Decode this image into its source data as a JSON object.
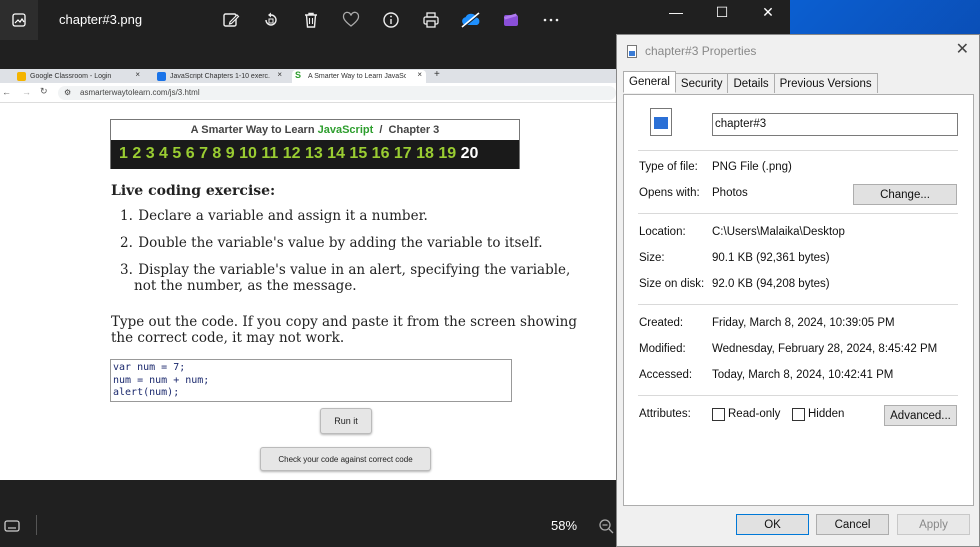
{
  "photos": {
    "file_name": "chapter#3.png",
    "zoom": "58%",
    "toolbar_icons": [
      "edit-image-icon",
      "rotate-icon",
      "delete-icon",
      "favorite-icon",
      "info-icon",
      "print-icon",
      "onedrive-icon",
      "clipchamp-icon",
      "more-icon"
    ],
    "window_controls": {
      "minimize": "—",
      "maximize": "☐",
      "close": "✕"
    }
  },
  "browser": {
    "tabs": [
      {
        "title": "Google Classroom - Login",
        "fav_color": "#f4b400"
      },
      {
        "title": "JavaScript Chapters 1-10 exerc...",
        "fav_color": "#1a73e8"
      },
      {
        "title": "A Smarter Way to Learn JavaSc...",
        "fav_color": "#2e9e2e",
        "active": true
      }
    ],
    "url": "asmarterwaytolearn.com/js/3.html"
  },
  "page": {
    "nav_title_prefix": "A Smarter Way to Learn ",
    "nav_title_js": "JavaScript",
    "nav_title_suffix": "  /  Chapter 3",
    "chapters": "1 2 3 4 5 6 7 8 9 10 11 12 13 14 15 16 17 18 19",
    "current_chapter": "20",
    "exercise_heading": "Live coding exercise:",
    "steps": [
      "Declare a variable and assign it a number.",
      "Double the variable's value by adding the variable to itself.",
      "Display the variable's value in an alert, specifying the variable, not the number, as the message."
    ],
    "instruction": "Type out the code. If you copy and paste it from the screen showing the correct code, it may not work.",
    "code": "var num = 7;\nnum = num + num;\nalert(num);",
    "run_button": "Run it",
    "check_button": "Check your code against correct code"
  },
  "dialog": {
    "title": "chapter#3 Properties",
    "tabs": [
      "General",
      "Security",
      "Details",
      "Previous Versions"
    ],
    "name": "chapter#3",
    "type_label": "Type of file:",
    "type_value": "PNG File (.png)",
    "opens_label": "Opens with:",
    "opens_value": "Photos",
    "change_button": "Change...",
    "location_label": "Location:",
    "location_value": "C:\\Users\\Malaika\\Desktop",
    "size_label": "Size:",
    "size_value": "90.1 KB (92,361 bytes)",
    "disk_label": "Size on disk:",
    "disk_value": "92.0 KB (94,208 bytes)",
    "created_label": "Created:",
    "created_value": "Friday, March 8, 2024, 10:39:05 PM",
    "modified_label": "Modified:",
    "modified_value": "Wednesday, February 28, 2024, 8:45:42 PM",
    "accessed_label": "Accessed:",
    "accessed_value": "Today, March 8, 2024, 10:42:41 PM",
    "attributes_label": "Attributes:",
    "readonly_label": "Read-only",
    "hidden_label": "Hidden",
    "advanced_button": "Advanced...",
    "ok_button": "OK",
    "cancel_button": "Cancel",
    "apply_button": "Apply"
  }
}
